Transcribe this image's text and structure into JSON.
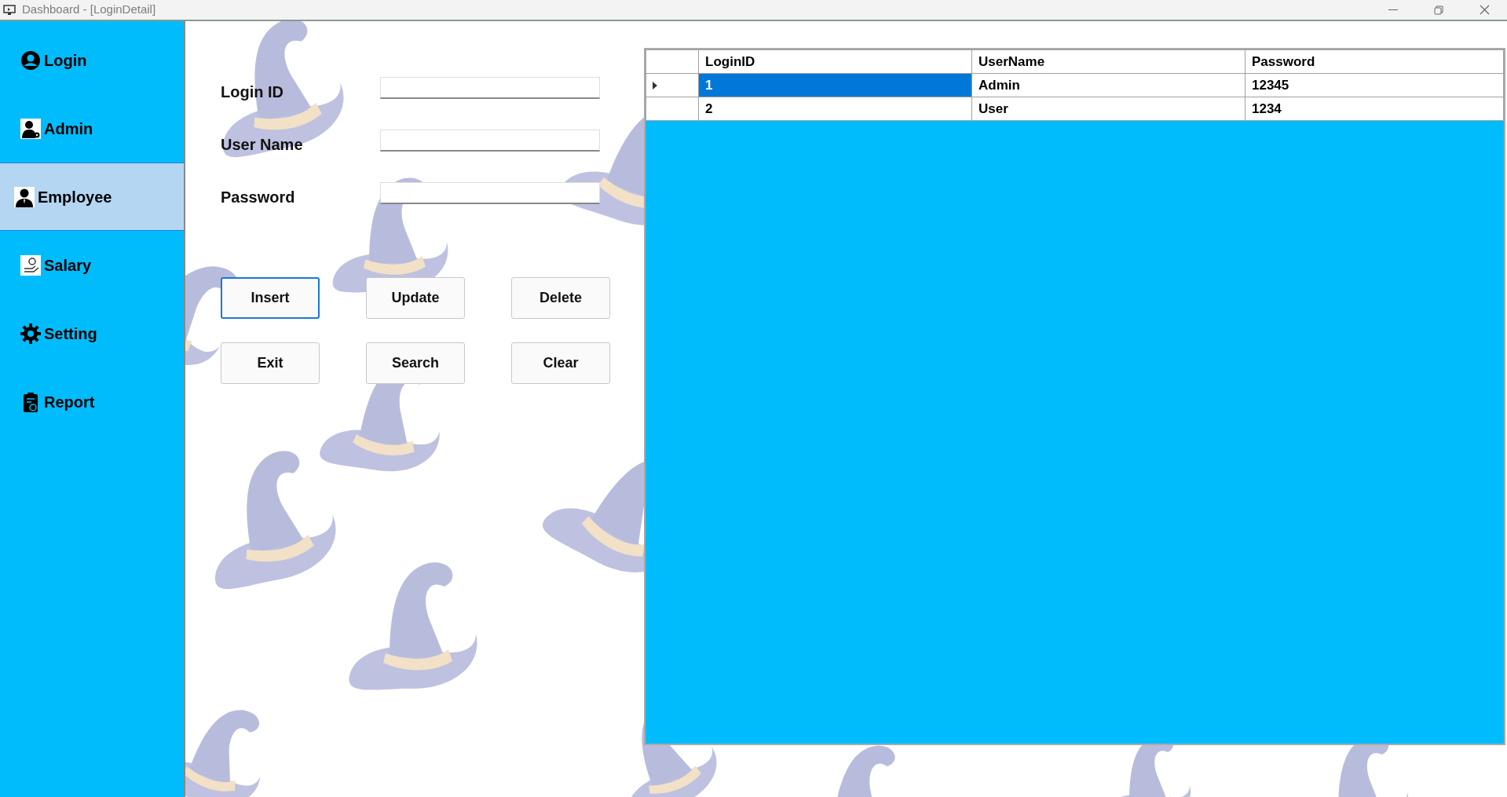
{
  "window": {
    "title": "Dashboard - [LoginDetail]"
  },
  "sidebar": {
    "items": [
      {
        "label": "Login",
        "selected": false
      },
      {
        "label": "Admin",
        "selected": false
      },
      {
        "label": "Employee",
        "selected": true
      },
      {
        "label": "Salary",
        "selected": false
      },
      {
        "label": "Setting",
        "selected": false
      },
      {
        "label": "Report",
        "selected": false
      }
    ]
  },
  "form": {
    "fields": [
      {
        "label": "Login ID"
      },
      {
        "label": "User Name"
      },
      {
        "label": "Password"
      }
    ],
    "buttons": [
      {
        "label": "Insert",
        "focused": true
      },
      {
        "label": "Update",
        "focused": false
      },
      {
        "label": "Delete",
        "focused": false
      },
      {
        "label": "Exit",
        "focused": false
      },
      {
        "label": "Search",
        "focused": false
      },
      {
        "label": "Clear",
        "focused": false
      }
    ]
  },
  "table": {
    "columns": [
      "LoginID",
      "UserName",
      "Password"
    ],
    "rows": [
      {
        "cells": [
          "1",
          "Admin",
          "12345"
        ],
        "selected": true
      },
      {
        "cells": [
          "2",
          "User",
          "1234"
        ],
        "selected": false
      }
    ]
  }
}
